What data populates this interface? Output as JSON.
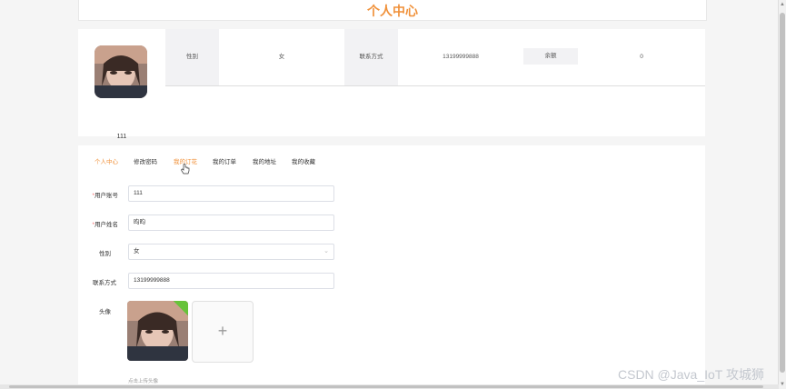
{
  "header": {
    "title": "个人中心"
  },
  "profile": {
    "username": "111",
    "nickname": "昀昀",
    "gender_label": "性别",
    "gender_value": "女",
    "contact_label": "联系方式",
    "contact_value": "13199999888",
    "balance_label": "余额",
    "balance_value": "0"
  },
  "tabs": [
    "个人中心",
    "修改密码",
    "我的订花",
    "我的订单",
    "我的地址",
    "我的收藏"
  ],
  "form": {
    "account_label": "用户账号",
    "account_value": "111",
    "name_label": "用户姓名",
    "name_value": "昀昀",
    "gender_label": "性别",
    "gender_value": "女",
    "contact_label": "联系方式",
    "contact_value": "13199999888",
    "avatar_label": "头像",
    "upload_hint": "点击上传头像"
  },
  "watermark": "CSDN @Java_IoT 攻城狮",
  "colors": {
    "accent": "#f0913a",
    "required": "#f56c6c",
    "success": "#67c23a"
  }
}
